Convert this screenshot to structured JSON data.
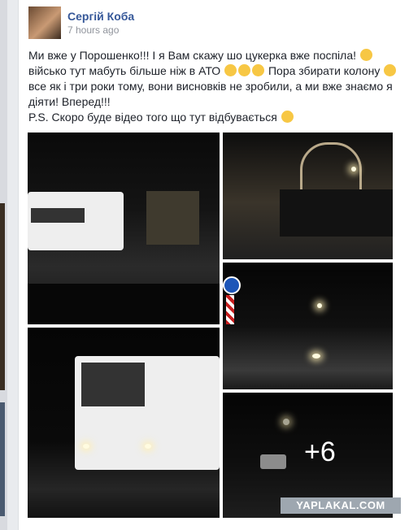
{
  "post": {
    "author": "Сергій Коба",
    "time": "7 hours ago",
    "lines": [
      "Ми вже у Порошенко!!! І я Вам скажу шо цукерка вже поспіла!",
      "військо тут мабуть більше ніж в АТО",
      "Пора збирати колону",
      "все як і три роки тому, вони висновків не зробили, а ми вже знаємо я",
      "діяти! Вперед!!!",
      "P.S. Скоро буде відео того що тут відбувається"
    ]
  },
  "gallery": {
    "more_count": "+6"
  },
  "watermark": "YAPLAKAL.COM",
  "colors": {
    "author": "#365899",
    "text": "#1d2129",
    "meta": "#90949c",
    "emoji": "#f7c744"
  }
}
